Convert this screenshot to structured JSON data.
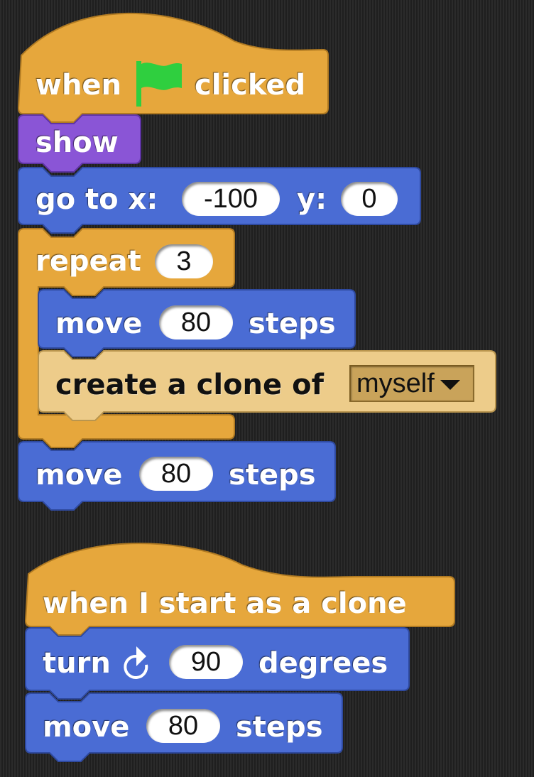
{
  "script1": {
    "hat": {
      "when": "when",
      "clicked": "clicked",
      "flag_icon": "green-flag-icon"
    },
    "show": {
      "label": "show"
    },
    "goto": {
      "label": "go to x:",
      "x_value": "-100",
      "y_label": "y:",
      "y_value": "0"
    },
    "repeat": {
      "label": "repeat",
      "count": "3"
    },
    "move_inner": {
      "label": "move",
      "value": "80",
      "suffix": "steps"
    },
    "clone": {
      "label": "create a clone of",
      "option": "myself"
    },
    "move_after": {
      "label": "move",
      "value": "80",
      "suffix": "steps"
    }
  },
  "script2": {
    "hat": {
      "label": "when I start as a clone"
    },
    "turn": {
      "label": "turn",
      "icon": "clockwise-arrow-icon",
      "value": "90",
      "suffix": "degrees"
    },
    "move": {
      "label": "move",
      "value": "80",
      "suffix": "steps"
    }
  },
  "colors": {
    "control": "#e6a73c",
    "looks": "#8a55d6",
    "motion": "#4a6cd4",
    "clone_block": "#edcc8a",
    "flag": "#2fcf3f"
  }
}
